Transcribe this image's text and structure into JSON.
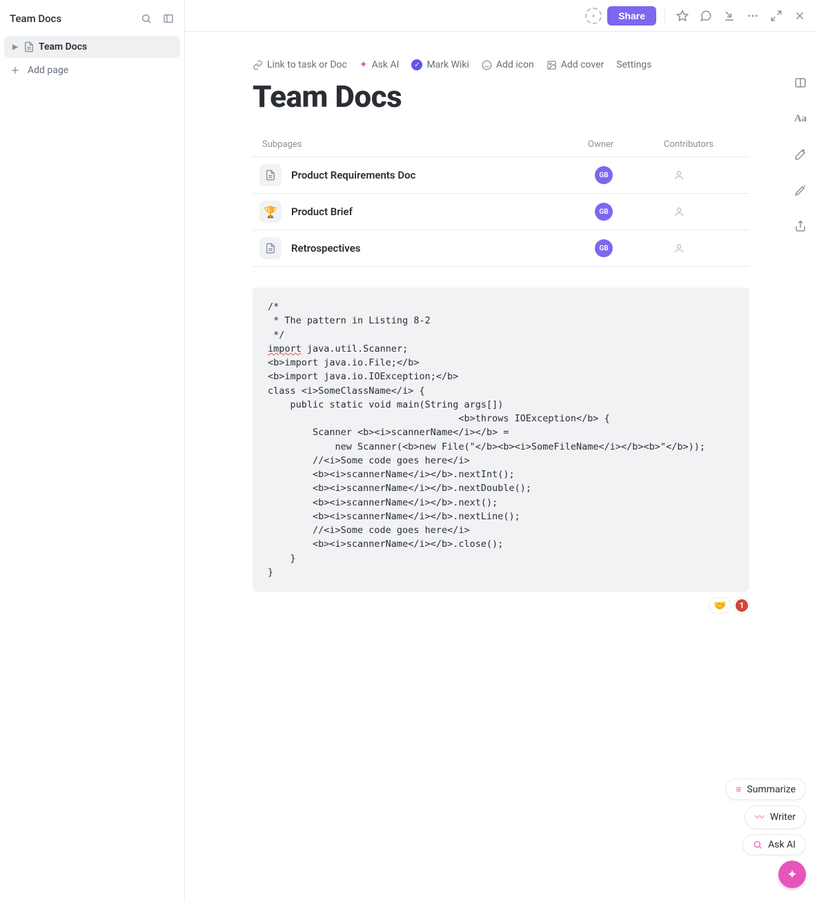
{
  "sidebar": {
    "title": "Team Docs",
    "tree_item": "Team Docs",
    "add_page": "Add page"
  },
  "topbar": {
    "share": "Share"
  },
  "doc": {
    "actions": {
      "link": "Link to task or Doc",
      "ask_ai": "Ask AI",
      "mark_wiki": "Mark Wiki",
      "add_icon": "Add icon",
      "add_cover": "Add cover",
      "settings": "Settings"
    },
    "title": "Team Docs",
    "subpages": {
      "header": {
        "name": "Subpages",
        "owner": "Owner",
        "contributors": "Contributors"
      },
      "rows": [
        {
          "icon": "doc",
          "name": "Product Requirements Doc",
          "owner": "GB"
        },
        {
          "icon": "trophy",
          "name": "Product Brief",
          "owner": "GB"
        },
        {
          "icon": "doc",
          "name": "Retrospectives",
          "owner": "GB"
        }
      ]
    },
    "code": "/*\n * The pattern in Listing 8-2\n */\n<SPELL>import</SPELL> java.util.Scanner;\n<b>import java.io.File;</b>\n<b>import java.io.IOException;</b>\nclass <i>SomeClassName</i> {\n    public static void main(String args[])\n                                  <b>throws IOException</b> {\n        Scanner <b><i>scannerName</i></b> =\n            new Scanner(<b>new File(\"</b><b><i>SomeFileName</i></b><b>\"</b>));\n        //<i>Some code goes here</i>\n        <b><i>scannerName</i></b>.nextInt();\n        <b><i>scannerName</i></b>.nextDouble();\n        <b><i>scannerName</i></b>.next();\n        <b><i>scannerName</i></b>.nextLine();\n        //<i>Some code goes here</i>\n        <b><i>scannerName</i></b>.close();\n    }\n}",
    "reaction_emoji": "🤝",
    "reaction_count": "1"
  },
  "right_rail_aa": "Aa",
  "floaters": {
    "summarize": "Summarize",
    "writer": "Writer",
    "ask_ai": "Ask AI"
  }
}
